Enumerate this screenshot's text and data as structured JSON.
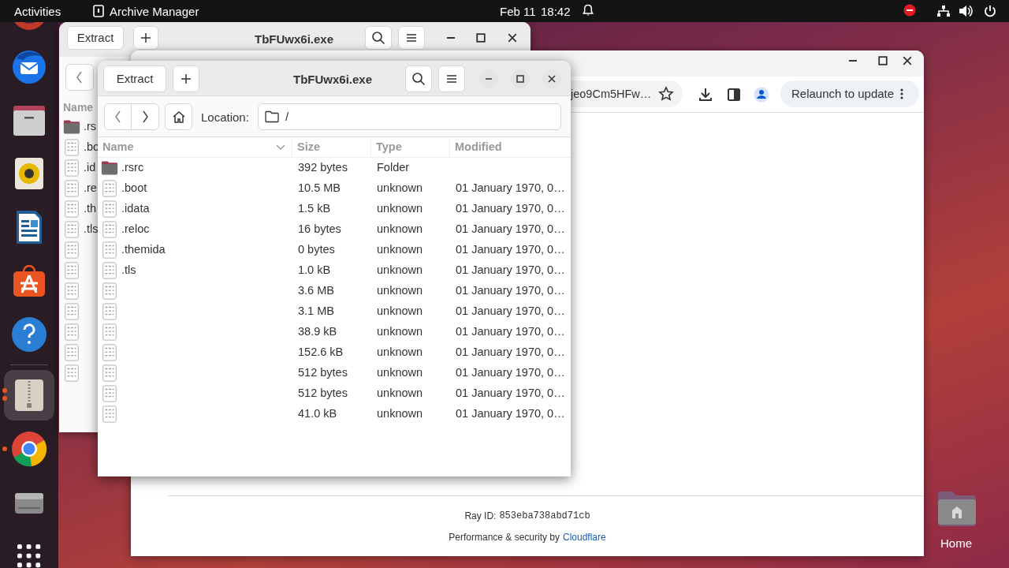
{
  "top_bar": {
    "activities": "Activities",
    "app_name": "Archive Manager",
    "date": "Feb 11",
    "time": "18:42"
  },
  "dock": [
    {
      "kind": "browser_cut",
      "running": false,
      "focused": false
    },
    {
      "kind": "mail",
      "running": false,
      "focused": false
    },
    {
      "kind": "files",
      "running": false,
      "focused": false
    },
    {
      "kind": "music",
      "running": false,
      "focused": false
    },
    {
      "kind": "writer",
      "running": false,
      "focused": false
    },
    {
      "kind": "store",
      "running": false,
      "focused": false
    },
    {
      "kind": "help",
      "running": false,
      "focused": false
    },
    {
      "kind": "separator"
    },
    {
      "kind": "archive",
      "running": true,
      "focused": true
    },
    {
      "kind": "chrome",
      "running": true,
      "focused": false
    },
    {
      "kind": "drive",
      "running": false,
      "focused": false
    },
    {
      "kind": "apps",
      "running": false,
      "focused": false
    }
  ],
  "desktop_icons": [
    {
      "label": "Home"
    }
  ],
  "back_window": {
    "extract": "Extract",
    "title": "TbFUwx6i.exe",
    "name_column": "Name",
    "rows": [
      {
        "kind": "folder",
        "name": ".rs"
      },
      {
        "kind": "file",
        "name": ".bo"
      },
      {
        "kind": "file",
        "name": ".id"
      },
      {
        "kind": "file",
        "name": ".re"
      },
      {
        "kind": "file",
        "name": ".th"
      },
      {
        "kind": "file",
        "name": ".tls"
      },
      {
        "kind": "file"
      },
      {
        "kind": "file"
      },
      {
        "kind": "file"
      },
      {
        "kind": "file"
      },
      {
        "kind": "file"
      },
      {
        "kind": "file"
      },
      {
        "kind": "file"
      }
    ]
  },
  "browser": {
    "url": "jeo9Cm5HFw…",
    "relaunch": "Relaunch to update",
    "ray_id_label": "Ray ID:",
    "ray_id": "853eba738abd71cb",
    "footer_text": "Performance & security by",
    "footer_link": "Cloudflare"
  },
  "front_window": {
    "extract": "Extract",
    "title": "TbFUwx6i.exe",
    "location_label": "Location:",
    "location": "/",
    "columns": [
      "Name",
      "Size",
      "Type",
      "Modified"
    ],
    "rows": [
      {
        "kind": "folder",
        "name": ".rsrc",
        "size": "392 bytes",
        "type": "Folder"
      },
      {
        "kind": "file",
        "name": ".boot",
        "size": "10.5 MB",
        "type": "unknown",
        "modified": "01 January 1970, 0…"
      },
      {
        "kind": "file",
        "name": ".idata",
        "size": "1.5 kB",
        "type": "unknown",
        "modified": "01 January 1970, 0…"
      },
      {
        "kind": "file",
        "name": ".reloc",
        "size": "16 bytes",
        "type": "unknown",
        "modified": "01 January 1970, 0…"
      },
      {
        "kind": "file",
        "name": ".themida",
        "size": "0 bytes",
        "type": "unknown",
        "modified": "01 January 1970, 0…"
      },
      {
        "kind": "file",
        "name": ".tls",
        "size": "1.0 kB",
        "type": "unknown",
        "modified": "01 January 1970, 0…"
      },
      {
        "kind": "file",
        "size": "3.6 MB",
        "type": "unknown",
        "modified": "01 January 1970, 0…"
      },
      {
        "kind": "file",
        "size": "3.1 MB",
        "type": "unknown",
        "modified": "01 January 1970, 0…"
      },
      {
        "kind": "file",
        "size": "38.9 kB",
        "type": "unknown",
        "modified": "01 January 1970, 0…"
      },
      {
        "kind": "file",
        "size": "152.6 kB",
        "type": "unknown",
        "modified": "01 January 1970, 0…"
      },
      {
        "kind": "file",
        "size": "512 bytes",
        "type": "unknown",
        "modified": "01 January 1970, 0…"
      },
      {
        "kind": "file",
        "size": "512 bytes",
        "type": "unknown",
        "modified": "01 January 1970, 0…"
      },
      {
        "kind": "file",
        "size": "41.0 kB",
        "type": "unknown",
        "modified": "01 January 1970, 0…"
      }
    ]
  }
}
